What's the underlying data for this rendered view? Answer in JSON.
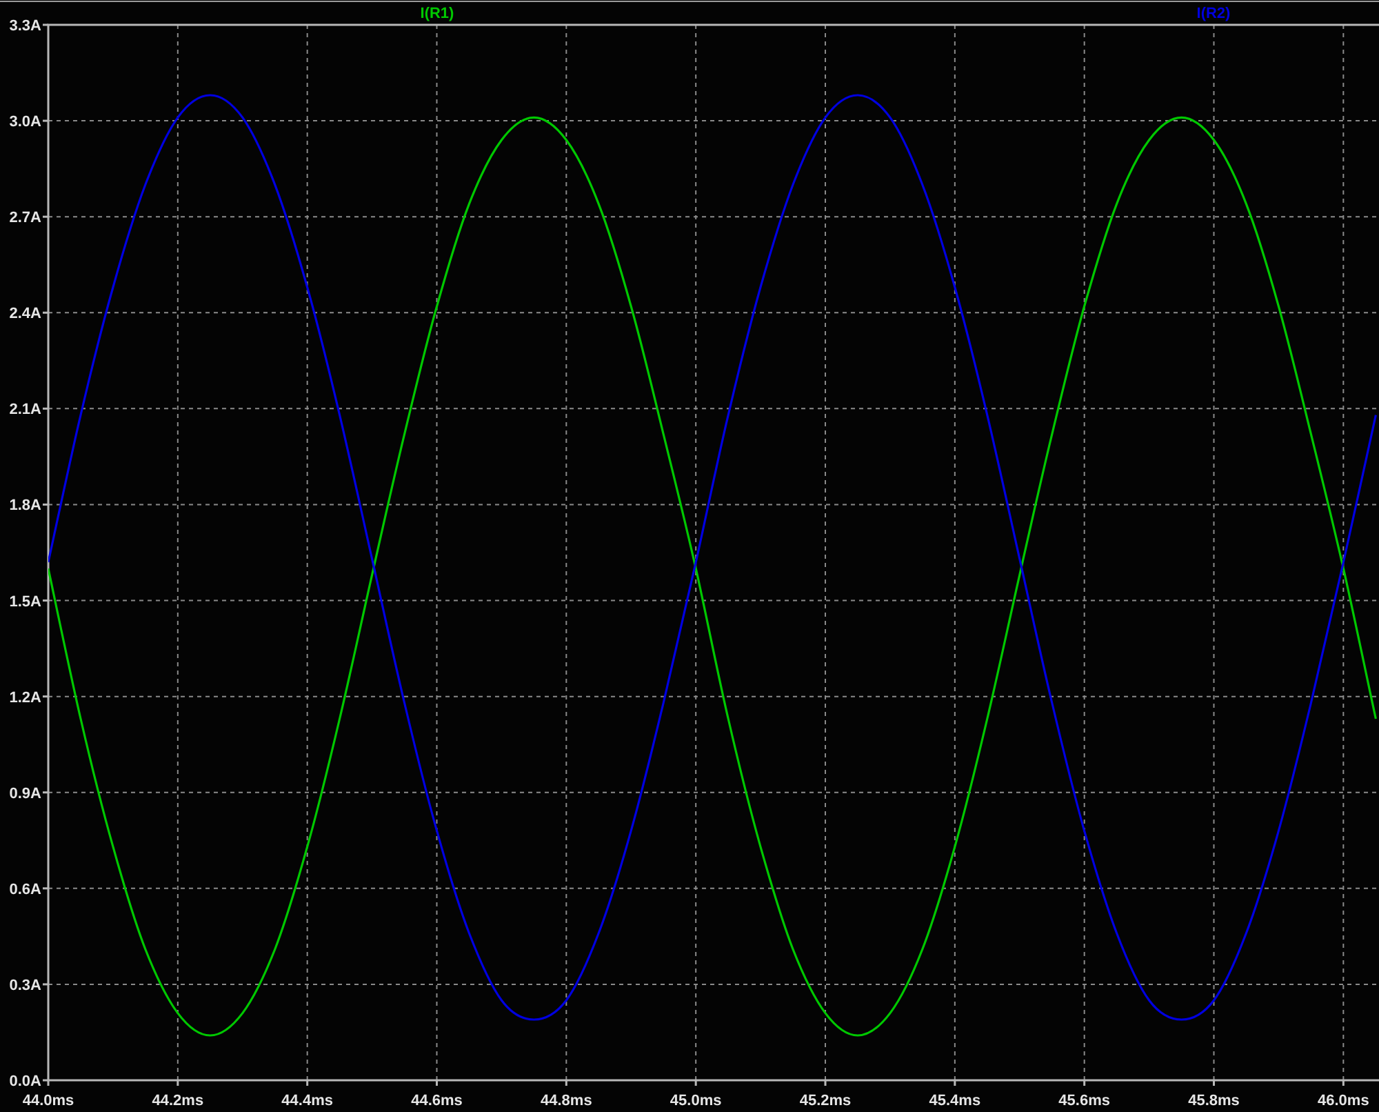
{
  "chart_data": {
    "type": "line",
    "grid": true,
    "x": [
      44.0,
      44.05,
      44.1,
      44.15,
      44.2,
      44.25,
      44.3,
      44.35,
      44.4,
      44.45,
      44.5,
      44.55,
      44.6,
      44.65,
      44.7,
      44.75,
      44.8,
      44.85,
      44.9,
      44.95,
      45.0,
      45.05,
      45.1,
      45.15,
      45.2,
      45.25,
      45.3,
      45.35,
      45.4,
      45.45,
      45.5,
      45.55,
      45.6,
      45.65,
      45.7,
      45.75,
      45.8,
      45.85,
      45.9,
      45.95,
      46.0,
      46.05
    ],
    "series": [
      {
        "name": "I(R1)",
        "color": "#00c800",
        "values": [
          1.6,
          1.13,
          0.73,
          0.41,
          0.21,
          0.14,
          0.21,
          0.41,
          0.73,
          1.13,
          1.58,
          2.02,
          2.42,
          2.74,
          2.94,
          3.01,
          2.94,
          2.74,
          2.42,
          2.02,
          1.6,
          1.13,
          0.73,
          0.41,
          0.21,
          0.14,
          0.21,
          0.41,
          0.73,
          1.13,
          1.58,
          2.02,
          2.42,
          2.74,
          2.94,
          3.01,
          2.94,
          2.74,
          2.42,
          2.02,
          1.6,
          1.13
        ]
      },
      {
        "name": "I(R2)",
        "color": "#0000e0",
        "values": [
          1.62,
          2.08,
          2.48,
          2.8,
          3.01,
          3.08,
          3.01,
          2.8,
          2.48,
          2.08,
          1.63,
          1.18,
          0.78,
          0.46,
          0.25,
          0.19,
          0.25,
          0.46,
          0.78,
          1.18,
          1.62,
          2.08,
          2.48,
          2.8,
          3.01,
          3.08,
          3.01,
          2.8,
          2.48,
          2.08,
          1.63,
          1.18,
          0.78,
          0.46,
          0.25,
          0.19,
          0.25,
          0.46,
          0.78,
          1.18,
          1.62,
          2.08
        ]
      }
    ],
    "xlim": [
      44.0,
      46.055
    ],
    "ylim": [
      0,
      3.3
    ],
    "xticks": [
      {
        "value": 44.0,
        "label": "44.0ms"
      },
      {
        "value": 44.2,
        "label": "44.2ms"
      },
      {
        "value": 44.4,
        "label": "44.4ms"
      },
      {
        "value": 44.6,
        "label": "44.6ms"
      },
      {
        "value": 44.8,
        "label": "44.8ms"
      },
      {
        "value": 45.0,
        "label": "45.0ms"
      },
      {
        "value": 45.2,
        "label": "45.2ms"
      },
      {
        "value": 45.4,
        "label": "45.4ms"
      },
      {
        "value": 45.6,
        "label": "45.6ms"
      },
      {
        "value": 45.8,
        "label": "45.8ms"
      },
      {
        "value": 46.0,
        "label": "46.0ms"
      }
    ],
    "yticks": [
      {
        "value": 0,
        "label": "0.0A"
      },
      {
        "value": 0.3,
        "label": "0.3A"
      },
      {
        "value": 0.6,
        "label": "0.6A"
      },
      {
        "value": 0.9,
        "label": "0.9A"
      },
      {
        "value": 1.2,
        "label": "1.2A"
      },
      {
        "value": 1.5,
        "label": "1.5A"
      },
      {
        "value": 1.8,
        "label": "1.8A"
      },
      {
        "value": 2.1,
        "label": "2.1A"
      },
      {
        "value": 2.4,
        "label": "2.4A"
      },
      {
        "value": 2.7,
        "label": "2.7A"
      },
      {
        "value": 3.0,
        "label": "3.0A"
      },
      {
        "value": 3.3,
        "label": "3.3A"
      }
    ]
  }
}
